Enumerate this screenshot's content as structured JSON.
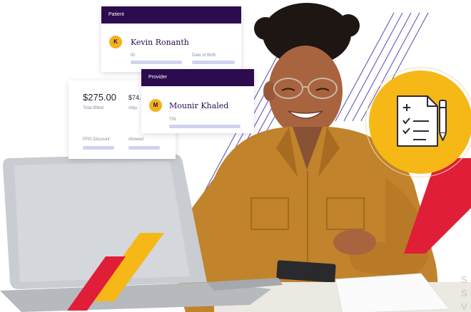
{
  "patient_card": {
    "header": "Patient",
    "avatar_letter": "K",
    "name": "Kevin Ronanth",
    "id_label": "ID",
    "dob_label": "Date of Birth"
  },
  "billing_card": {
    "total_amount": "$275.00",
    "total_label": "Total Billed",
    "adjusted_amount": "$74.",
    "adjusted_label": "Adju",
    "ppo_label": "PPO Discount",
    "allowed_label": "Allowed"
  },
  "provider_card": {
    "header": "Provider",
    "avatar_letter": "M",
    "name": "Mounir Khaled",
    "tin_label": "TIN"
  },
  "claim_icon": "claim-form-checklist-icon",
  "corner_text": [
    "S",
    "S",
    "V"
  ],
  "colors": {
    "brand_purple": "#2c0b4e",
    "accent_yellow": "#f6b817",
    "accent_red": "#e01e37",
    "field_bar": "#cfd3ef"
  }
}
